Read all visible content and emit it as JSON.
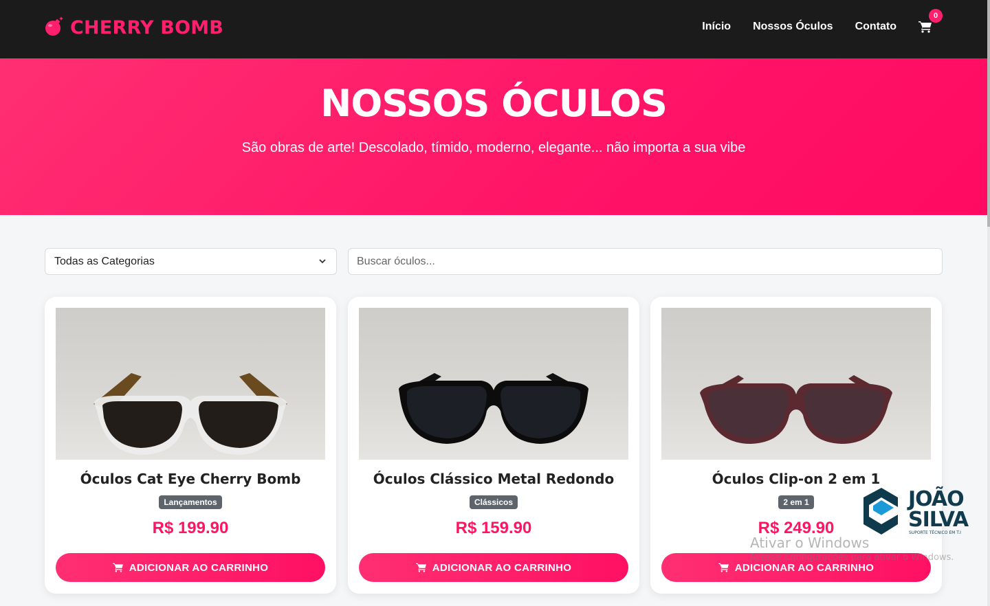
{
  "brand": {
    "name": "CHERRY BOMB",
    "icon": "bomb-icon",
    "color": "#ff1f6d"
  },
  "nav": {
    "links": [
      {
        "label": "Início"
      },
      {
        "label": "Nossos Óculos"
      },
      {
        "label": "Contato"
      }
    ],
    "cart_icon": "cart-icon",
    "cart_count": "0"
  },
  "hero": {
    "title": "NOSSOS ÓCULOS",
    "subtitle": "São obras de arte! Descolado, tímido, moderno, elegante... não importa a sua vibe",
    "gradient": [
      "#ff2f73",
      "#ff0a62"
    ]
  },
  "filters": {
    "category_selected": "Todas as Categorias",
    "search_placeholder": "Buscar óculos..."
  },
  "products": [
    {
      "title": "Óculos Cat Eye Cherry Bomb",
      "category": "Lançamentos",
      "price": "R$ 199.90",
      "button": "ADICIONAR AO CARRINHO"
    },
    {
      "title": "Óculos Clássico Metal Redondo",
      "category": "Clássicos",
      "price": "R$ 159.90",
      "button": "ADICIONAR AO CARRINHO"
    },
    {
      "title": "Óculos Clip-on 2 em 1",
      "category": "2 em 1",
      "price": "R$ 249.90",
      "button": "ADICIONAR AO CARRINHO"
    }
  ],
  "overlays": {
    "windows_title": "Ativar o Windows",
    "windows_sub": "Acesse Configurações para ativar o Windows.",
    "logo_name_line1": "JOÃO",
    "logo_name_line2": "SILVA",
    "logo_tagline": "SUPORTE TÉCNICO EM T.I"
  },
  "colors": {
    "accent": "#ff1466",
    "navbar": "#1b1b1b",
    "badge": "#5e646c"
  }
}
